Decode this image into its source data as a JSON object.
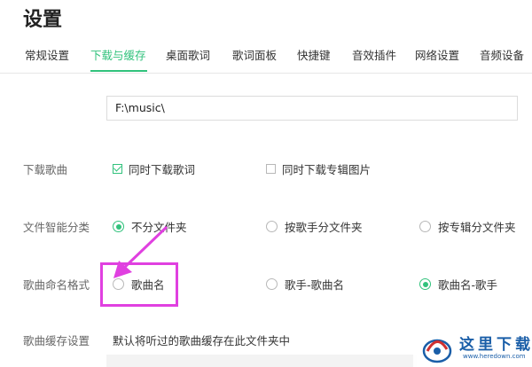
{
  "window": {
    "title": "设置"
  },
  "tabs": [
    {
      "label": "常规设置"
    },
    {
      "label": "下载与缓存",
      "active": true
    },
    {
      "label": "桌面歌词"
    },
    {
      "label": "歌词面板"
    },
    {
      "label": "快捷键"
    },
    {
      "label": "音效插件"
    },
    {
      "label": "网络设置"
    },
    {
      "label": "音频设备"
    }
  ],
  "download_dir": {
    "value": "F:\\music\\"
  },
  "download_songs": {
    "label": "下载歌曲",
    "options": [
      {
        "label": "同时下载歌词",
        "checked": true
      },
      {
        "label": "同时下载专辑图片",
        "checked": false
      }
    ]
  },
  "smart_classify": {
    "label": "文件智能分类",
    "options": [
      {
        "label": "不分文件夹",
        "selected": true
      },
      {
        "label": "按歌手分文件夹",
        "selected": false
      },
      {
        "label": "按专辑分文件夹",
        "selected": false
      }
    ]
  },
  "naming_format": {
    "label": "歌曲命名格式",
    "options": [
      {
        "label": "歌曲名",
        "selected": false
      },
      {
        "label": "歌手-歌曲名",
        "selected": false
      },
      {
        "label": "歌曲名-歌手",
        "selected": true
      }
    ]
  },
  "cache": {
    "label": "歌曲缓存设置",
    "description": "默认将听过的歌曲缓存在此文件夹中"
  },
  "watermark": {
    "text": "这里下载",
    "url": "www.heredown.com"
  },
  "colors": {
    "accent": "#31c27c",
    "annotation": "#e040e0",
    "watermark": "#1a5ea8"
  }
}
